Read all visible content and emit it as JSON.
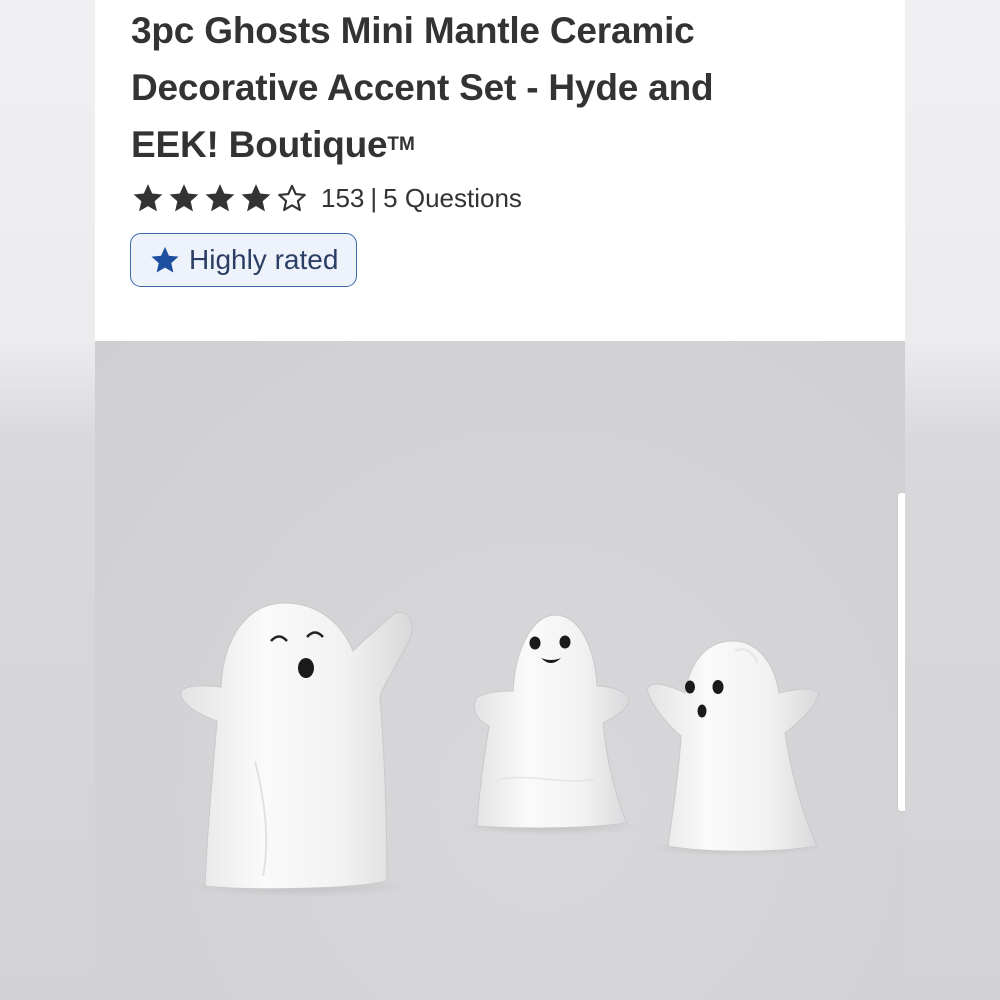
{
  "product": {
    "title_line1": "3pc Ghosts Mini Mantle Ceramic",
    "title_line2": "Decorative Accent Set - Hyde and",
    "title_line3": "EEK! Boutique",
    "trademark": "TM"
  },
  "rating": {
    "stars": 4,
    "max_stars": 5,
    "review_count": "153",
    "separator": "|",
    "questions_label": "5 Questions"
  },
  "badge": {
    "label": "Highly rated",
    "icon": "star-icon"
  },
  "colors": {
    "text": "#333333",
    "badge_border": "#3a6aa8",
    "badge_star": "#1d4f9e",
    "star_fill": "#333333"
  },
  "product_image": {
    "icon": "ghost-figurines"
  }
}
